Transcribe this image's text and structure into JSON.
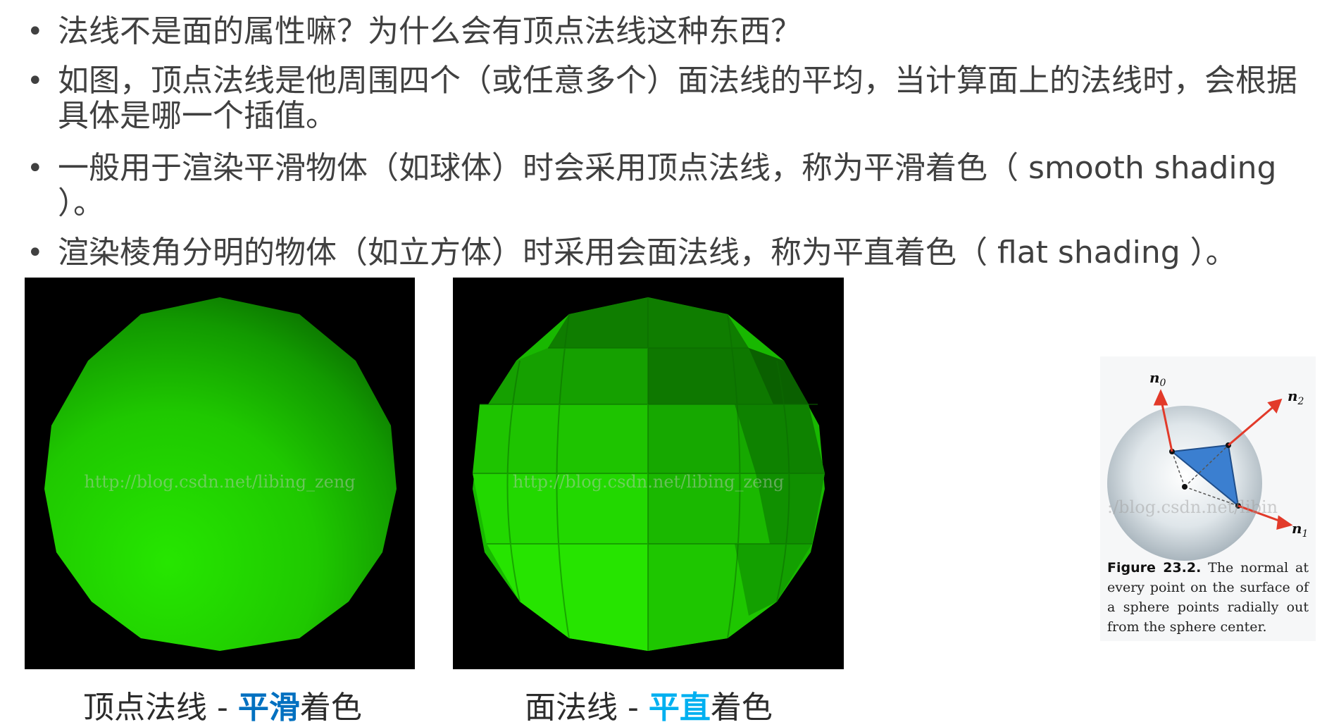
{
  "bullet_symbol": "•",
  "bullets": [
    "法线不是面的属性嘛？为什么会有顶点法线这种东西？",
    "如图，顶点法线是他周围四个（或任意多个）面法线的平均，当计算面上的法线时，会根据具体是哪一个插值。",
    "一般用于渲染平滑物体（如球体）时会采用顶点法线，称为平滑着色（ smooth shading ）。",
    "渲染棱角分明的物体（如立方体）时采用会面法线，称为平直着色（ flat shading ）。"
  ],
  "figures": {
    "smooth": {
      "watermark": "http://blog.csdn.net/libing_zeng",
      "caption_prefix": "顶点法线 - ",
      "caption_highlight": "平滑",
      "caption_suffix": "着色"
    },
    "flat": {
      "watermark": "http://blog.csdn.net/libing_zeng",
      "caption_prefix": "面法线 - ",
      "caption_highlight": "平直",
      "caption_suffix": "着色"
    },
    "book": {
      "labels": {
        "n0": "n",
        "n0_sub": "0",
        "n1": "n",
        "n1_sub": "1",
        "n2": "n",
        "n2_sub": "2"
      },
      "watermark": ":/blog.csdn.net/libin",
      "caption_number": "Figure 23.2.",
      "caption_text": "The normal at every point on the surface of a sphere points radially out from the sphere center."
    }
  },
  "colors": {
    "sphere_green": "#22e000",
    "highlight_smooth": "#0070c0",
    "highlight_flat": "#00b0f0",
    "triangle_blue": "#3b7fd0",
    "arrow_red": "#e23a2a"
  }
}
